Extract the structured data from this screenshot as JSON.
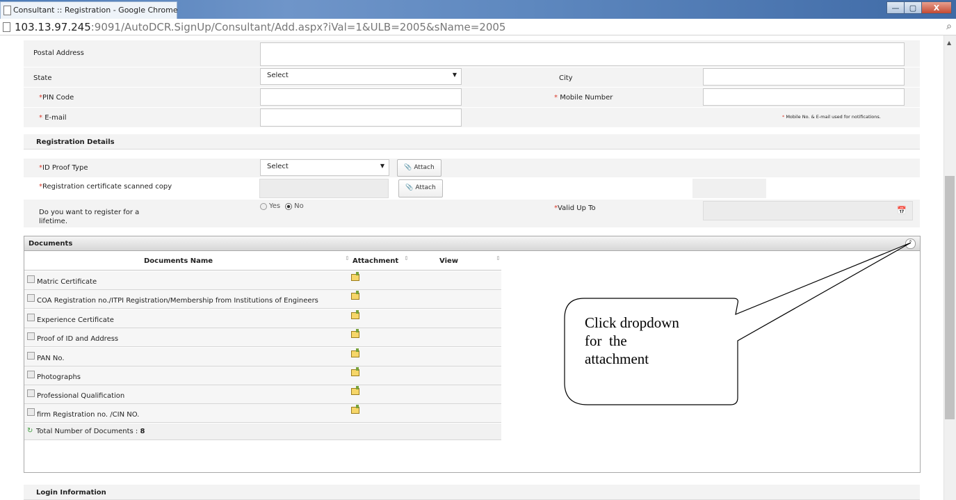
{
  "window": {
    "title": "Consultant :: Registration - Google Chrome",
    "url_host": "103.13.97.245",
    "url_rest": ":9091/AutoDCR.SignUp/Consultant/Add.aspx?iVal=1&ULB=2005&sName=2005",
    "controls": {
      "minimize": "—",
      "maximize": "▢",
      "close": "X"
    }
  },
  "contact": {
    "postal_address_label": "Postal Address",
    "state_label": "State",
    "state_value": "Select",
    "city_label": "City",
    "pin_label": "PIN Code",
    "mobile_label": "Mobile Number",
    "email_label": "E-mail",
    "required_mark": "*",
    "notification_note": "Mobile No. & E-mail used for notifications."
  },
  "registration": {
    "section_title": "Registration Details",
    "id_proof_label": "ID Proof Type",
    "id_proof_value": "Select",
    "attach_label": "Attach",
    "cert_copy_label": "Registration certificate scanned copy",
    "lifetime_label_1": "Do you want to register for a",
    "lifetime_label_2": "lifetime.",
    "radio_yes": "Yes",
    "radio_no": "No",
    "radio_selected": "No",
    "valid_up_to_label": "Valid Up To"
  },
  "documents": {
    "section_title": "Documents",
    "columns": [
      "Documents Name",
      "Attachment",
      "View"
    ],
    "rows": [
      "Matric Certificate",
      "COA Registration no./ITPI Registration/Membership from Institutions of Engineers",
      "Experience Certificate",
      "Proof of ID and Address",
      "PAN No.",
      "Photographs",
      "Professional Qualification",
      " firm Registration no. /CIN NO."
    ],
    "total_label": "Total Number of Documents : ",
    "total_count": "8"
  },
  "callout": {
    "line1": "Click dropdown",
    "line2": "for  the",
    "line3": "attachment"
  },
  "login": {
    "section_title": "Login Information"
  },
  "icons": [
    "page-icon",
    "zoom-icon",
    "dropdown-arrow-icon",
    "attach-icon",
    "calendar-icon",
    "collapse-icon",
    "sort-icon",
    "refresh-icon",
    "scroll-up-icon"
  ]
}
